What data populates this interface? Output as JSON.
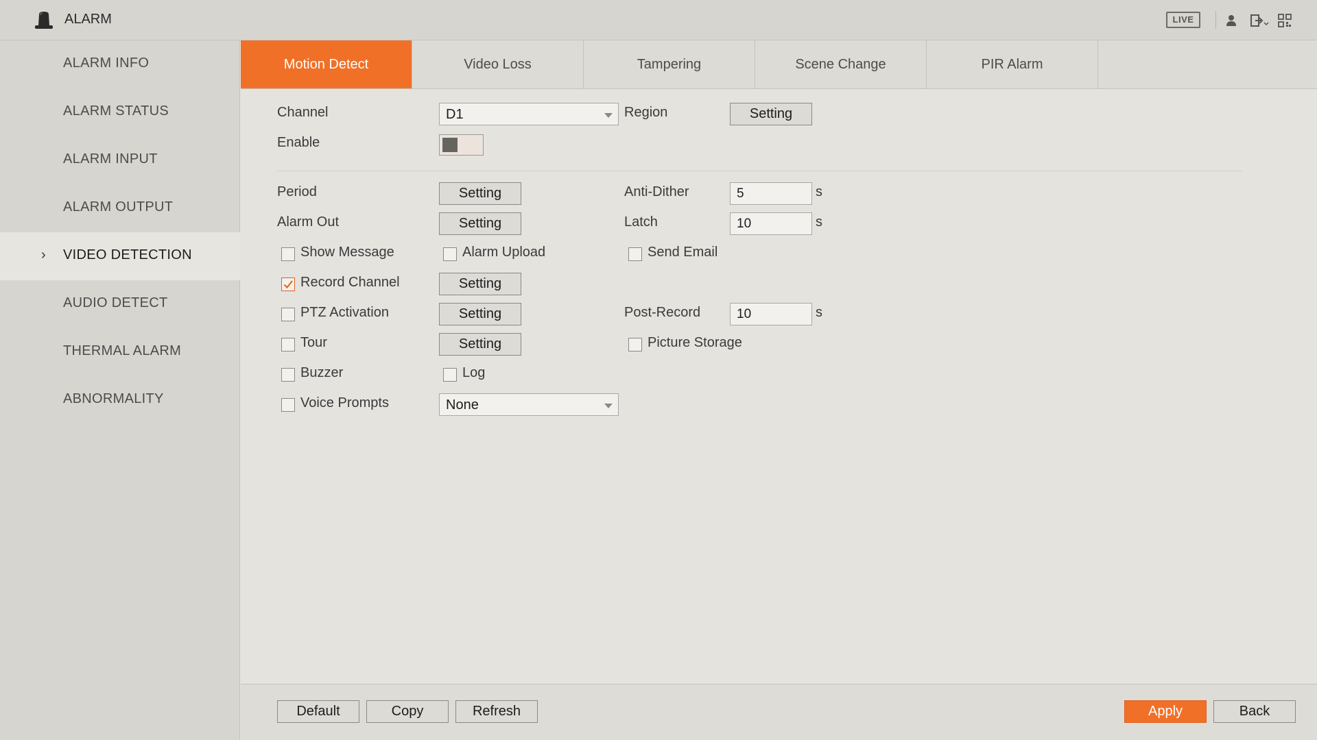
{
  "header": {
    "title": "ALARM",
    "app_icon": "alarm-bell-icon",
    "live_label": "LIVE",
    "icons": [
      "user-icon",
      "logout-icon",
      "qr-code-icon"
    ]
  },
  "sidebar": {
    "items": [
      {
        "label": "ALARM INFO"
      },
      {
        "label": "ALARM STATUS"
      },
      {
        "label": "ALARM INPUT"
      },
      {
        "label": "ALARM OUTPUT"
      },
      {
        "label": "VIDEO DETECTION",
        "active": true
      },
      {
        "label": "AUDIO DETECT"
      },
      {
        "label": "THERMAL ALARM"
      },
      {
        "label": "ABNORMALITY"
      }
    ],
    "chevron": "›"
  },
  "tabs": [
    {
      "label": "Motion Detect",
      "active": true
    },
    {
      "label": "Video Loss"
    },
    {
      "label": "Tampering"
    },
    {
      "label": "Scene Change"
    },
    {
      "label": "PIR Alarm"
    }
  ],
  "form": {
    "channel": {
      "label": "Channel",
      "value": "D1"
    },
    "region": {
      "label": "Region",
      "button": "Setting"
    },
    "enable": {
      "label": "Enable",
      "on": false
    },
    "period": {
      "label": "Period",
      "button": "Setting"
    },
    "anti_dither": {
      "label": "Anti-Dither",
      "value": "5",
      "unit": "s"
    },
    "alarm_out": {
      "label": "Alarm Out",
      "button": "Setting"
    },
    "latch": {
      "label": "Latch",
      "value": "10",
      "unit": "s"
    },
    "show_message": {
      "label": "Show Message",
      "checked": false
    },
    "alarm_upload": {
      "label": "Alarm Upload",
      "checked": false
    },
    "send_email": {
      "label": "Send Email",
      "checked": false
    },
    "record_channel": {
      "label": "Record Channel",
      "checked": true,
      "button": "Setting"
    },
    "ptz_activation": {
      "label": "PTZ Activation",
      "checked": false,
      "button": "Setting"
    },
    "post_record": {
      "label": "Post-Record",
      "value": "10",
      "unit": "s"
    },
    "tour": {
      "label": "Tour",
      "checked": false,
      "button": "Setting"
    },
    "picture_storage": {
      "label": "Picture Storage",
      "checked": false
    },
    "buzzer": {
      "label": "Buzzer",
      "checked": false
    },
    "log": {
      "label": "Log",
      "checked": false
    },
    "voice_prompts": {
      "label": "Voice Prompts",
      "checked": false,
      "value": "None"
    }
  },
  "footer": {
    "default": "Default",
    "copy": "Copy",
    "refresh": "Refresh",
    "apply": "Apply",
    "back": "Back"
  },
  "colors": {
    "accent": "#f07028",
    "background": "#e4e3de",
    "sidebar": "#d6d5d0"
  }
}
